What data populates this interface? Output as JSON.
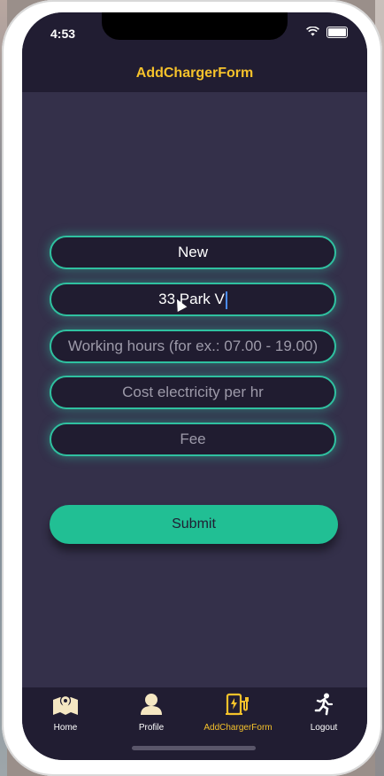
{
  "status": {
    "time": "4:53"
  },
  "navbar": {
    "title": "AddChargerForm"
  },
  "form": {
    "name_value": "New",
    "address_value": "33 Park V",
    "hours_placeholder": "Working hours (for ex.: 07.00 - 19.00)",
    "cost_placeholder": "Cost electricity per hr",
    "fee_placeholder": "Fee",
    "submit_label": "Submit"
  },
  "tabs": [
    {
      "label": "Home",
      "icon": "map-icon"
    },
    {
      "label": "Profile",
      "icon": "person-icon"
    },
    {
      "label": "AddChargerForm",
      "icon": "ev-charger-icon"
    },
    {
      "label": "Logout",
      "icon": "running-person-icon"
    }
  ],
  "colors": {
    "accent": "#f6c22b",
    "teal": "#21bf94",
    "background": "#34304a",
    "bar": "#211d32"
  }
}
